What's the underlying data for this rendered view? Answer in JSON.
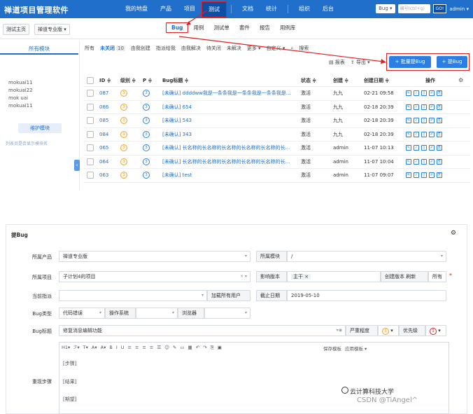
{
  "topbar": {
    "brand": "禅道项目管理软件",
    "nav": [
      "我的地盘",
      "产品",
      "项目",
      "测试",
      "文档",
      "统计",
      "组织",
      "后台"
    ],
    "active_nav": "测试",
    "product_select": "Bug ▾",
    "search_placeholder": "编号(ctrl+g)",
    "go": "GO!",
    "user": "admin ▾"
  },
  "subbar": {
    "crumb_home": "测试主页",
    "crumb_product": "禅道专业版 ▾",
    "tabs": [
      "Bug",
      "用例",
      "测试单",
      "套件",
      "报告",
      "用例库"
    ]
  },
  "sidebar": {
    "title": "所有模块",
    "modules": [
      "mokuai11",
      "mokuai22",
      "mok uai",
      "mokuai11"
    ],
    "maintain": "维护模块",
    "hint": "列表页是否显示模块名"
  },
  "filters": {
    "items": [
      "所有",
      "未关闭",
      "由我创建",
      "指派给我",
      "由我解决",
      "待关闭",
      "未解决",
      "更多 ▾",
      "自定义 ▾",
      "搜索"
    ],
    "unclosed_count": "10"
  },
  "actions": {
    "report": "报表",
    "export": "导出 ▾",
    "batch_add": "+ 批量提Bug",
    "add": "+ 提Bug"
  },
  "table": {
    "headers": {
      "id": "ID ≑",
      "severity": "级别 ≑",
      "priority": "P ≑",
      "title": "Bug标题 ≑",
      "status": "状态 ≑",
      "creator": "创建 ≑",
      "date": "创建日期 ≑",
      "ops": "操作"
    },
    "rows": [
      {
        "id": "087",
        "sev": "3",
        "pri": "3",
        "title": "[未确认] ddddww我是一条条我是一条条我是一条条我是...",
        "status": "激活",
        "creator": "九九",
        "date": "02-21 09:58"
      },
      {
        "id": "086",
        "sev": "3",
        "pri": "3",
        "title": "[未确认] 654",
        "status": "激活",
        "creator": "九九",
        "date": "02-18 20:39"
      },
      {
        "id": "085",
        "sev": "3",
        "pri": "3",
        "title": "[未确认] 543",
        "status": "激活",
        "creator": "九九",
        "date": "02-18 20:39"
      },
      {
        "id": "084",
        "sev": "3",
        "pri": "3",
        "title": "[未确认] 343",
        "status": "激活",
        "creator": "九九",
        "date": "02-18 20:39"
      },
      {
        "id": "065",
        "sev": "3",
        "pri": "3",
        "title": "[未确认] 长名称的长名称的长名称的长名称的长名称的长...",
        "status": "激活",
        "creator": "admin",
        "date": "11-07 10:13"
      },
      {
        "id": "064",
        "sev": "3",
        "pri": "3",
        "title": "[未确认] 长名称的长名称的长名称的长名称的长名称的长...",
        "status": "激活",
        "creator": "admin",
        "date": "11-07 10:04"
      },
      {
        "id": "063",
        "sev": "3",
        "pri": "3",
        "title": "[未确认] test",
        "status": "激活",
        "creator": "admin",
        "date": "11-07 09:07"
      }
    ]
  },
  "form": {
    "title": "提Bug",
    "product_label": "所属产品",
    "product_value": "禅道专业版",
    "module_label": "所属模块",
    "module_value": "/",
    "project_label": "所属项目",
    "project_value": "子计划4的项目",
    "version_label": "影响版本",
    "version_tag": "主干 ×",
    "create_version": "创建版本",
    "refresh": "刷新",
    "all": "所有",
    "assign_label": "当前指派",
    "load_users": "加载所有用户",
    "deadline_label": "截止日期",
    "deadline_value": "2019-05-10",
    "type_label": "Bug类型",
    "type_value": "代码错误",
    "os_label": "操作系统",
    "browser_label": "浏览器",
    "bug_title_label": "Bug标题",
    "bug_title_value": "修复消息编辑功能",
    "severity_label": "严重程度",
    "severity_value": "3",
    "priority_label": "优先级",
    "priority_value": "1",
    "steps_label": "重现步骤",
    "toolbar": [
      "H1▾",
      "ℱ▾",
      "T▾",
      "A▾",
      "A▾",
      "B",
      "I",
      "U",
      "≡",
      "≡",
      "≡",
      "≡",
      "☰",
      "☺",
      "✎",
      "▭",
      "▦",
      "↶",
      "↷",
      "⎘",
      "▣",
      "保存模板",
      "应用模板 ▾"
    ],
    "step_lines": [
      "[步骤]",
      "[结果]",
      "[期望]"
    ]
  },
  "watermark": {
    "line1": "云计算科技大学",
    "line2": "CSDN @TiAngel^"
  }
}
